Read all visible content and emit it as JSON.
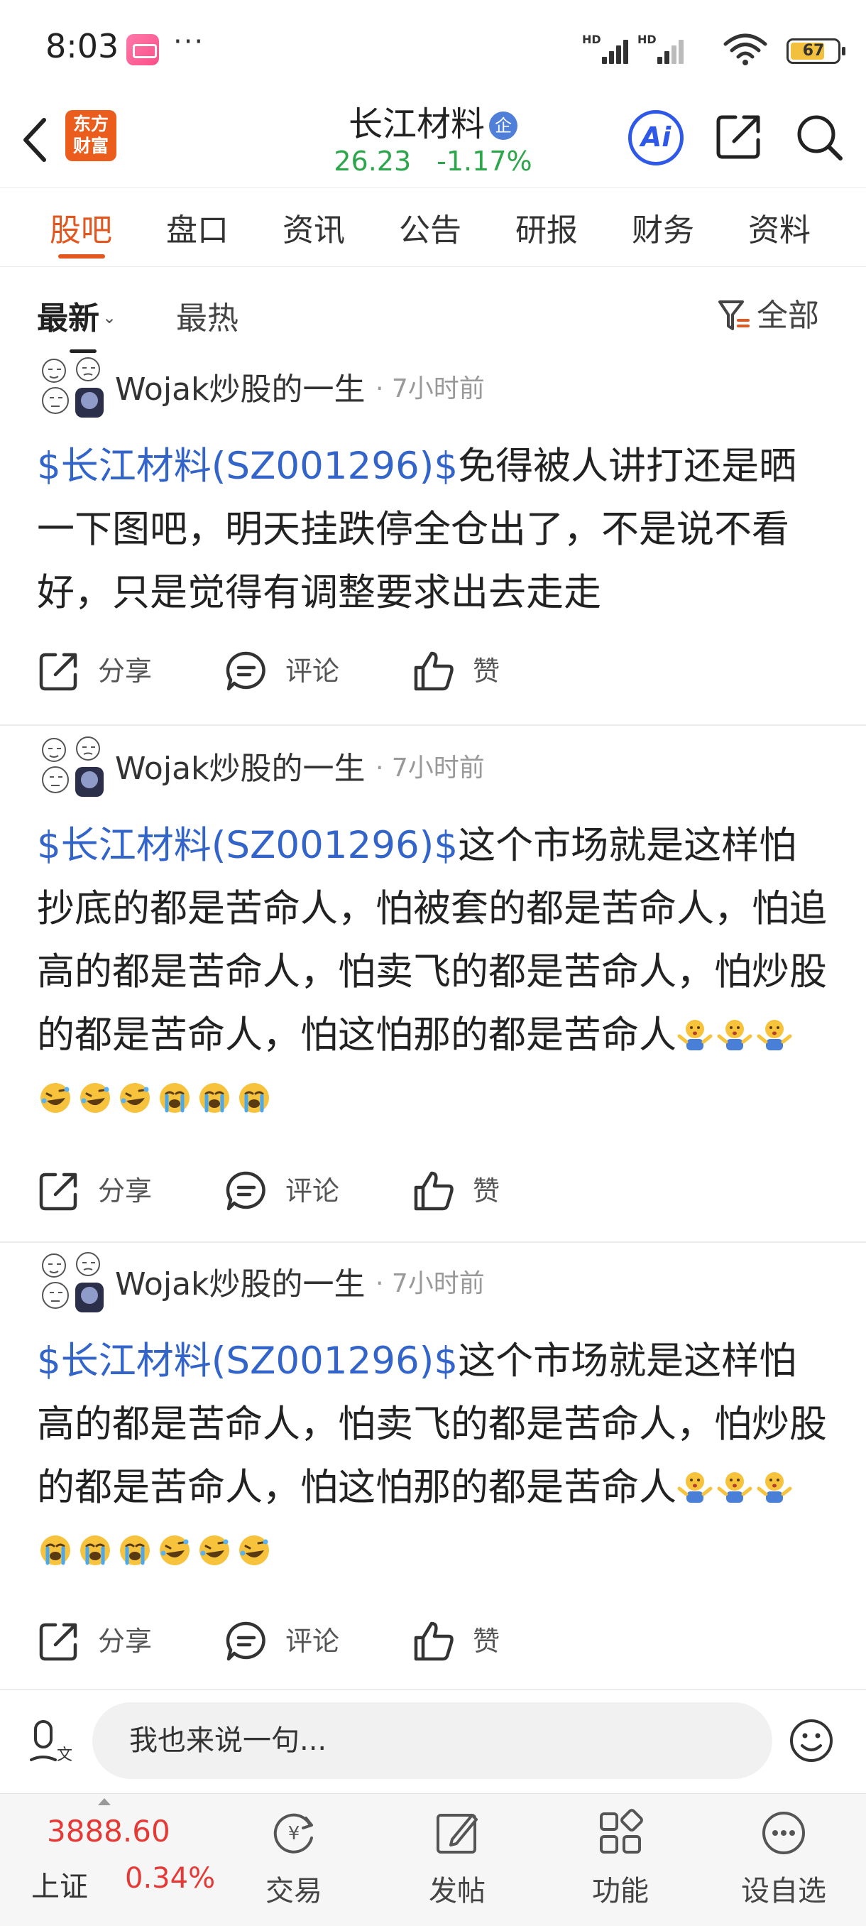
{
  "status_bar": {
    "time": "8:03",
    "dots": "···",
    "battery": "67"
  },
  "header": {
    "logo_line1": "东方",
    "logo_line2": "财富",
    "stock_name": "长江材料",
    "badge": "企",
    "price": "26.23",
    "change_pct": "-1.17%",
    "ai_label": "Ai"
  },
  "tabs": [
    {
      "label": "股吧"
    },
    {
      "label": "盘口"
    },
    {
      "label": "资讯"
    },
    {
      "label": "公告"
    },
    {
      "label": "研报"
    },
    {
      "label": "财务"
    },
    {
      "label": "资料"
    }
  ],
  "sort": {
    "latest": "最新",
    "hottest": "最热",
    "filter": "全部"
  },
  "posts": [
    {
      "author": "Wojak炒股的一生",
      "time": "7小时前",
      "tag": "$长江材料(SZ001296)$",
      "text": "免得被人讲打还是晒一下图吧，明天挂跌停全仓出了，不是说不看好，只是觉得有调整要求出去走走",
      "emojis": []
    },
    {
      "author": "Wojak炒股的一生",
      "time": "7小时前",
      "tag": "$长江材料(SZ001296)$",
      "text": "这个市场就是这样怕抄底的都是苦命人，怕被套的都是苦命人，怕追高的都是苦命人，怕卖飞的都是苦命人，怕炒股的都是苦命人，怕这怕那的都是苦命人",
      "emojis": [
        "shrug",
        "shrug",
        "shrug",
        "laugh",
        "laugh",
        "laugh",
        "cry",
        "cry",
        "cry"
      ]
    },
    {
      "author": "Wojak炒股的一生",
      "time": "7小时前",
      "tag": "$长江材料(SZ001296)$",
      "text": "这个市场就是这样怕高的都是苦命人，怕卖飞的都是苦命人，怕炒股的都是苦命人，怕这怕那的都是苦命人",
      "emojis": [
        "shrug",
        "shrug",
        "shrug",
        "cry",
        "cry",
        "cry",
        "laugh",
        "laugh",
        "laugh"
      ]
    }
  ],
  "actions": {
    "share": "分享",
    "comment": "评论",
    "like": "赞"
  },
  "comment_bar": {
    "placeholder": "我也来说一句..."
  },
  "bottom_bar": {
    "index_value": "3888.60",
    "index_name": "上证",
    "index_change": "0.34%",
    "nav": [
      {
        "label": "交易"
      },
      {
        "label": "发帖"
      },
      {
        "label": "功能"
      },
      {
        "label": "设自选"
      }
    ]
  },
  "colors": {
    "accent": "#e2561f",
    "link": "#3264c9",
    "green": "#2ca64a",
    "red": "#e53935",
    "ai_blue": "#2e58e8"
  }
}
